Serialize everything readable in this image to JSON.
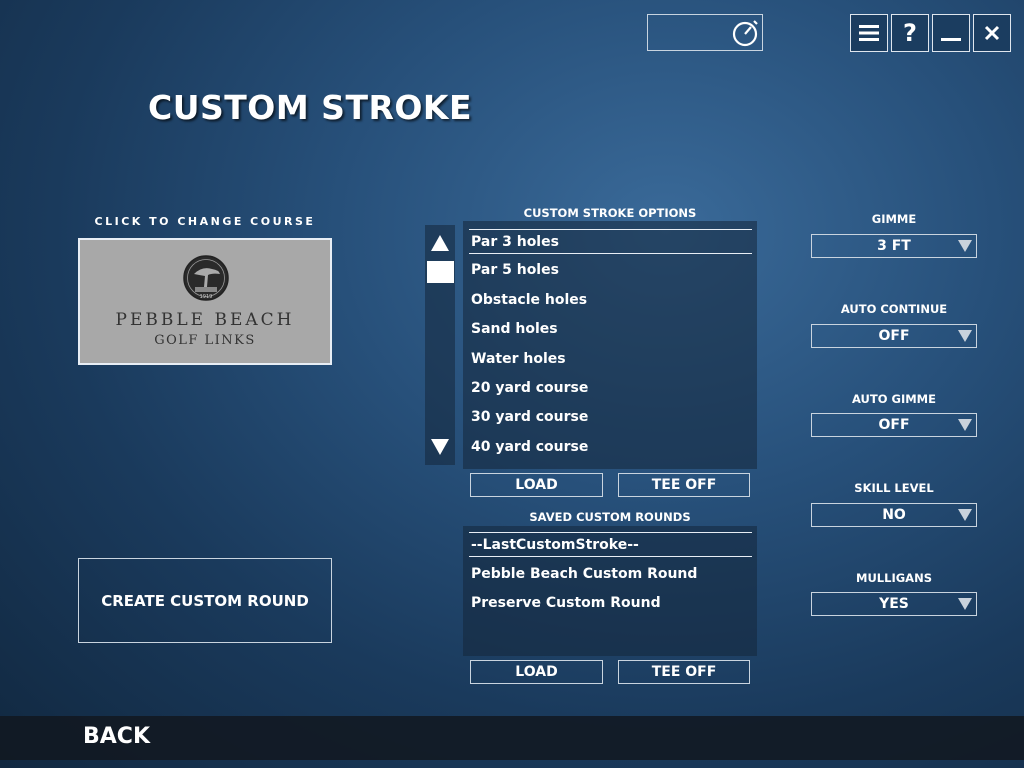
{
  "page_title": "CUSTOM STROKE",
  "window_controls": {
    "menu_icon": "hamburger-menu-icon",
    "help_label": "?",
    "minimize_icon": "minimize-icon",
    "close_icon": "close-icon"
  },
  "timer": {
    "icon": "stopwatch-icon"
  },
  "course": {
    "caption": "CLICK TO CHANGE COURSE",
    "logo_line1": "PEBBLE BEACH",
    "logo_line2": "GOLF LINKS",
    "logo_year": "1919"
  },
  "create_button": "CREATE CUSTOM ROUND",
  "options_list": {
    "header": "CUSTOM STROKE OPTIONS",
    "items": [
      "Par 3 holes",
      "Par 5 holes",
      "Obstacle holes",
      "Sand holes",
      "Water holes",
      "20 yard course",
      "30 yard course",
      "40 yard course"
    ],
    "selected_index": 0,
    "load_label": "LOAD",
    "teeoff_label": "TEE OFF"
  },
  "saved_list": {
    "header": "SAVED CUSTOM ROUNDS",
    "items": [
      "--LastCustomStroke--",
      "Pebble Beach Custom Round",
      "Preserve Custom Round"
    ],
    "selected_index": 0,
    "load_label": "LOAD",
    "teeoff_label": "TEE OFF"
  },
  "settings": [
    {
      "label": "GIMME",
      "value": "3 FT"
    },
    {
      "label": "AUTO CONTINUE",
      "value": "OFF"
    },
    {
      "label": "AUTO GIMME",
      "value": "OFF"
    },
    {
      "label": "SKILL LEVEL",
      "value": "NO"
    },
    {
      "label": "MULLIGANS",
      "value": "YES"
    }
  ],
  "back_label": "BACK"
}
